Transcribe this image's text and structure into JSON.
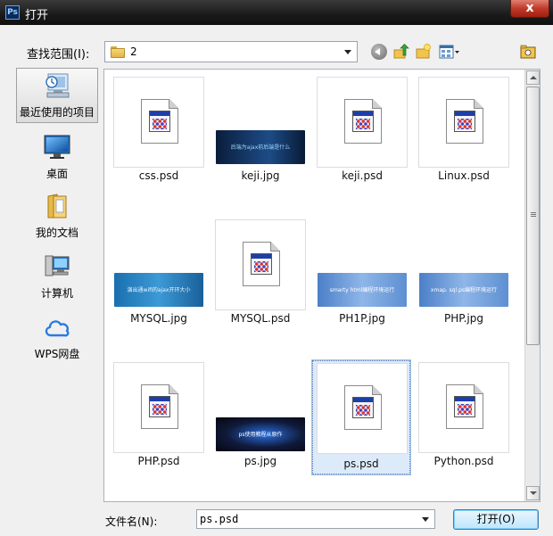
{
  "window": {
    "title": "打开",
    "app_icon": "ps-icon",
    "close_symbol": "x"
  },
  "lookin": {
    "label": "查找范围(I):",
    "value": "2"
  },
  "places": [
    {
      "label": "最近使用的项目",
      "icon": "recent-items-icon",
      "selected": true
    },
    {
      "label": "桌面",
      "icon": "desktop-icon"
    },
    {
      "label": "我的文档",
      "icon": "documents-icon"
    },
    {
      "label": "计算机",
      "icon": "computer-icon"
    },
    {
      "label": "WPS网盘",
      "icon": "cloud-icon"
    }
  ],
  "files": [
    {
      "name": "css.psd",
      "type": "psd"
    },
    {
      "name": "keji.jpg",
      "type": "jpg",
      "thumb_text": "后端为ajax前后端是什么"
    },
    {
      "name": "keji.psd",
      "type": "psd"
    },
    {
      "name": "Linux.psd",
      "type": "psd"
    },
    {
      "name": "MYSQL.jpg",
      "type": "jpg",
      "thumb_text": "演出通wifi的ajax开环大小"
    },
    {
      "name": "MYSQL.psd",
      "type": "psd"
    },
    {
      "name": "PH1P.jpg",
      "type": "jpg",
      "thumb_text": "smarty html编程环境运行"
    },
    {
      "name": "PHP.jpg",
      "type": "jpg",
      "thumb_text": "xmap. sql.ps编程环境运行"
    },
    {
      "name": "PHP.psd",
      "type": "psd"
    },
    {
      "name": "ps.jpg",
      "type": "jpg",
      "thumb_text": "ps使用教程从原作"
    },
    {
      "name": "ps.psd",
      "type": "psd",
      "selected": true
    },
    {
      "name": "Python.psd",
      "type": "psd"
    }
  ],
  "filename": {
    "label": "文件名(N):",
    "value": "ps.psd"
  },
  "buttons": {
    "open": "打开(O)"
  },
  "colors": {
    "selection": "#dceaf9",
    "titlebar": "#1a1a1a"
  }
}
